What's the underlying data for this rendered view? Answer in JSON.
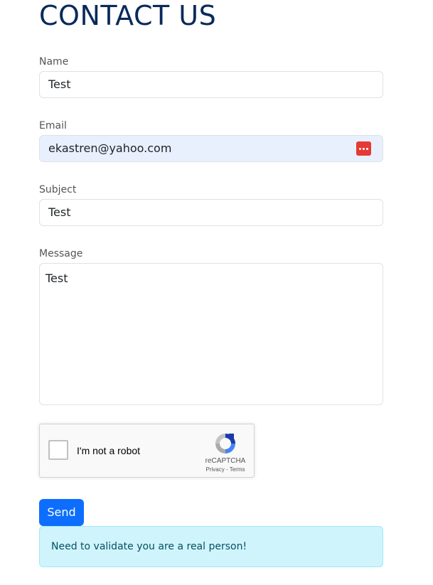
{
  "page": {
    "title": "CONTACT US"
  },
  "form": {
    "name": {
      "label": "Name",
      "value": "Test"
    },
    "email": {
      "label": "Email",
      "value": "ekastren@yahoo.com",
      "autofilled": true
    },
    "subject": {
      "label": "Subject",
      "value": "Test"
    },
    "message": {
      "label": "Message",
      "value": "Test"
    }
  },
  "recaptcha": {
    "label": "I'm not a robot",
    "brand": "reCAPTCHA",
    "links": "Privacy - Terms",
    "checked": false
  },
  "actions": {
    "send_label": "Send"
  },
  "alert": {
    "message": "Need to validate you are a real person!"
  },
  "colors": {
    "title": "#0a2a5a",
    "primary": "#0d6efd",
    "autofill_bg": "#e8f0fe",
    "alert_bg": "#cff4fc",
    "alert_text": "#055160",
    "password_manager_icon": "#e53935"
  },
  "icons": {
    "password_manager": "password-manager-icon",
    "recaptcha_logo": "recaptcha-logo-icon"
  }
}
